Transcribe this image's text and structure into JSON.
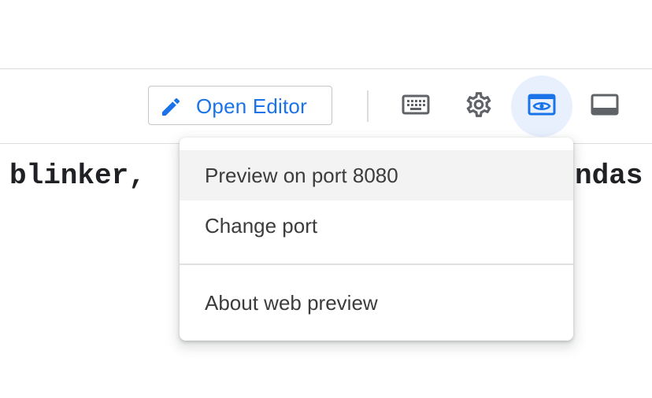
{
  "toolbar": {
    "open_editor_label": "Open Editor",
    "icons": [
      "keyboard-icon",
      "settings-gear-icon",
      "web-preview-icon",
      "terminal-panel-icon"
    ],
    "accent_color": "#1a73e8",
    "active_bg": "#e8f0fe"
  },
  "editor": {
    "code_left": "blinker,",
    "code_right": "ndas"
  },
  "web_preview_menu": {
    "items": [
      {
        "label": "Preview on port 8080"
      },
      {
        "label": "Change port"
      },
      {
        "label": "About web preview"
      }
    ]
  }
}
